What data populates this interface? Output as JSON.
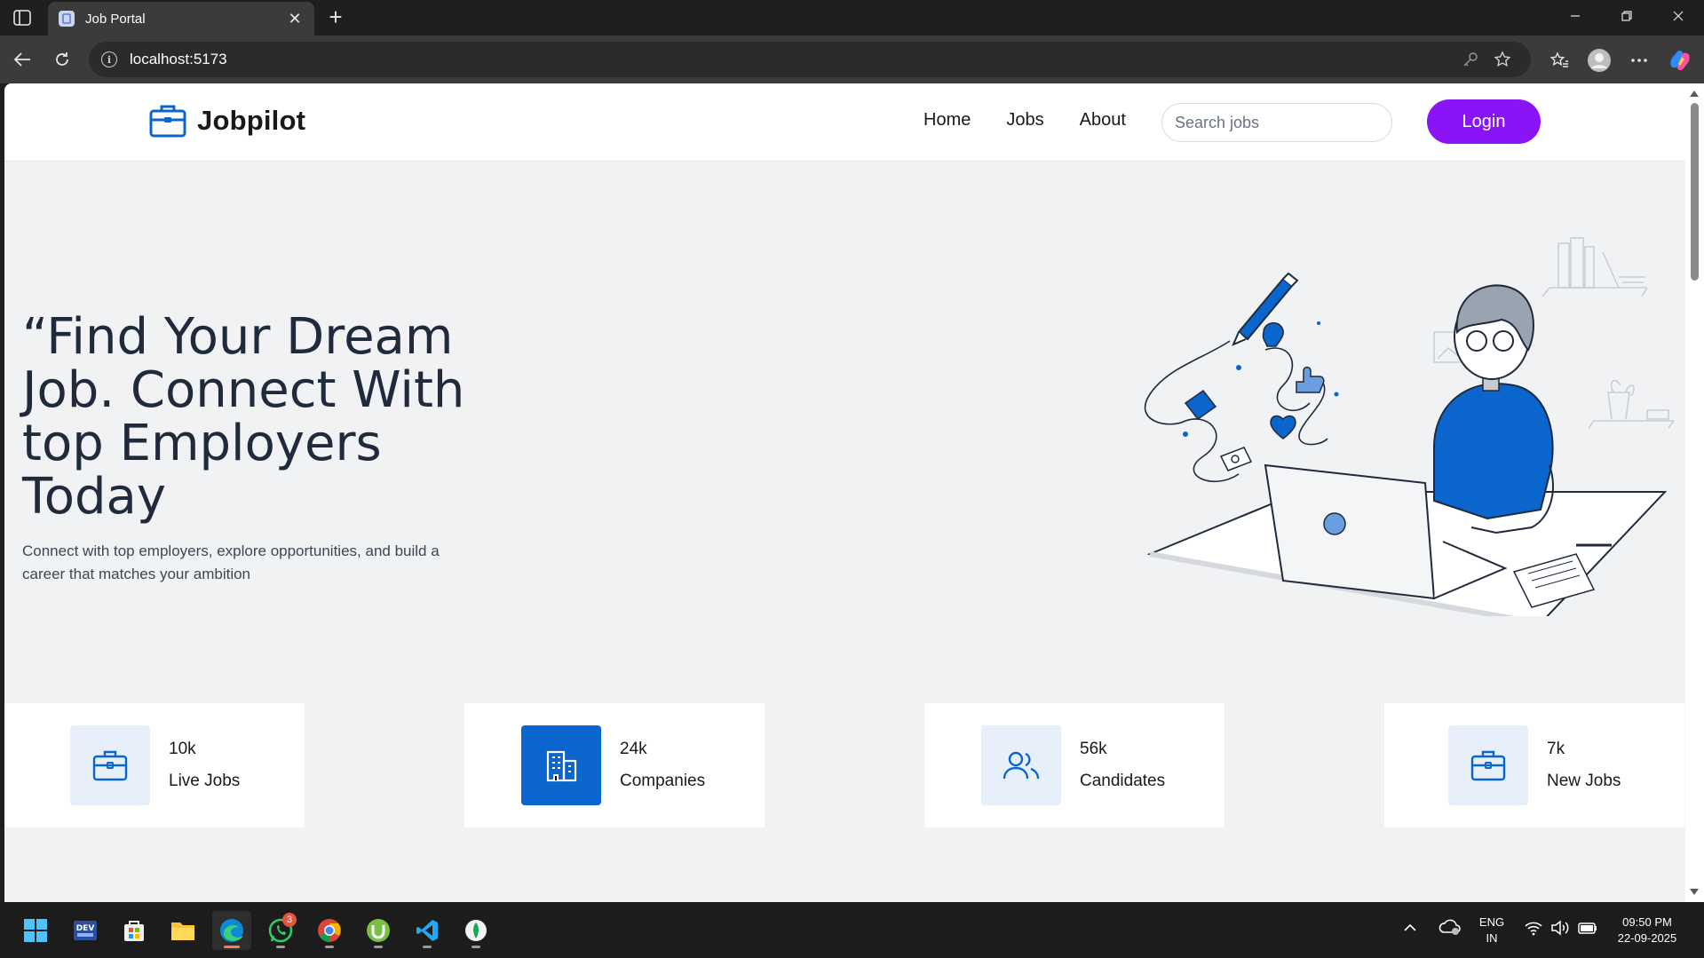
{
  "browser": {
    "tab_title": "Job Portal",
    "url": "localhost:5173"
  },
  "site": {
    "brand": "Jobpilot",
    "nav": [
      "Home",
      "Jobs",
      "About"
    ],
    "search_placeholder": "Search jobs",
    "login_label": "Login",
    "accent_color": "#8a14f5",
    "primary_color": "#0a65cc"
  },
  "hero": {
    "title": "“Find Your Dream Job. Connect With top Employers Today",
    "subtitle": "Connect with top employers, explore opportunities, and build a career that matches your ambition"
  },
  "stats": [
    {
      "value": "10k",
      "label": "Live Jobs",
      "icon": "briefcase-icon"
    },
    {
      "value": "24k",
      "label": "Companies",
      "icon": "building-icon"
    },
    {
      "value": "56k",
      "label": "Candidates",
      "icon": "users-icon"
    },
    {
      "value": "7k",
      "label": "New Jobs",
      "icon": "briefcase-icon"
    }
  ],
  "taskbar": {
    "whatsapp_badge": "3",
    "lang_line1": "ENG",
    "lang_line2": "IN",
    "time": "09:50 PM",
    "date": "22-09-2025"
  }
}
